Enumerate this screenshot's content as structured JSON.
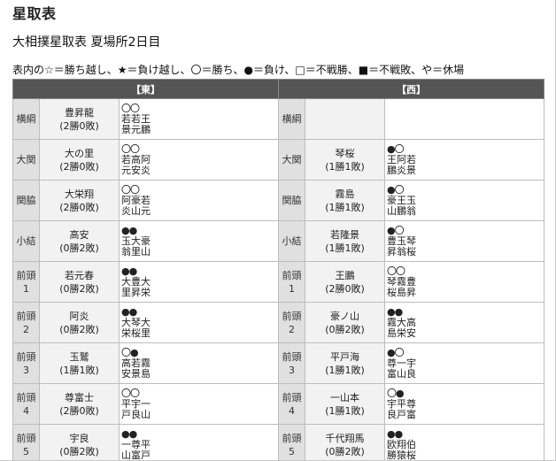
{
  "page": {
    "title": "星取表",
    "subtitle": "大相撲星取表 夏場所2日目",
    "legend": "表内の☆＝勝ち越し、★＝負け越し、〇＝勝ち、●＝負け、□＝不戦勝、■＝不戦敗、や＝休場"
  },
  "table": {
    "east_header": "【東】",
    "west_header": "【西】",
    "rows": [
      {
        "east": {
          "rank": "横綱",
          "name": "豊昇龍",
          "record": "(2勝0敗)",
          "marks": "〇〇",
          "opp1": "若若王",
          "opp2": "景元鵬"
        },
        "west": {
          "rank": "横綱",
          "name": "",
          "record": "",
          "marks": "",
          "opp1": "",
          "opp2": ""
        }
      },
      {
        "east": {
          "rank": "大関",
          "name": "大の里",
          "record": "(2勝0敗)",
          "marks": "〇〇",
          "opp1": "若高阿",
          "opp2": "元安炎"
        },
        "west": {
          "rank": "大関",
          "name": "琴桜",
          "record": "(1勝1敗)",
          "marks": "●〇",
          "opp1": "王阿若",
          "opp2": "鵬炎景"
        }
      },
      {
        "east": {
          "rank": "関脇",
          "name": "大栄翔",
          "record": "(2勝0敗)",
          "marks": "〇〇",
          "opp1": "阿豪若",
          "opp2": "炎山元"
        },
        "west": {
          "rank": "関脇",
          "name": "霧島",
          "record": "(1勝1敗)",
          "marks": "●〇",
          "opp1": "豪王玉",
          "opp2": "山鵬翁"
        }
      },
      {
        "east": {
          "rank": "小結",
          "name": "高安",
          "record": "(0勝2敗)",
          "marks": "●●",
          "opp1": "玉大豪",
          "opp2": "翁里山"
        },
        "west": {
          "rank": "小結",
          "name": "若隆景",
          "record": "(1勝1敗)",
          "marks": "●〇",
          "opp1": "豊玉琴",
          "opp2": "昇翁桜"
        }
      },
      {
        "east": {
          "rank": "前頭\n1",
          "name": "若元春",
          "record": "(0勝2敗)",
          "marks": "●●",
          "opp1": "大豊大",
          "opp2": "里昇栄"
        },
        "west": {
          "rank": "前頭\n1",
          "name": "王鵬",
          "record": "(2勝0敗)",
          "marks": "〇〇",
          "opp1": "琴霧豊",
          "opp2": "桜島昇"
        }
      },
      {
        "east": {
          "rank": "前頭\n2",
          "name": "阿炎",
          "record": "(0勝2敗)",
          "marks": "●●",
          "opp1": "大琴大",
          "opp2": "栄桜里"
        },
        "west": {
          "rank": "前頭\n2",
          "name": "豪ノ山",
          "record": "(0勝2敗)",
          "marks": "●●",
          "opp1": "霧大高",
          "opp2": "島栄安"
        }
      },
      {
        "east": {
          "rank": "前頭\n3",
          "name": "玉鷲",
          "record": "(1勝1敗)",
          "marks": "〇●",
          "opp1": "高若霧",
          "opp2": "安景島"
        },
        "west": {
          "rank": "前頭\n3",
          "name": "平戸海",
          "record": "(1勝1敗)",
          "marks": "●〇",
          "opp1": "尊一宇",
          "opp2": "富山良"
        }
      },
      {
        "east": {
          "rank": "前頭\n4",
          "name": "尊富士",
          "record": "(2勝0敗)",
          "marks": "〇〇",
          "opp1": "平宇一",
          "opp2": "戸良山"
        },
        "west": {
          "rank": "前頭\n4",
          "name": "一山本",
          "record": "(1勝1敗)",
          "marks": "〇●",
          "opp1": "宇平尊",
          "opp2": "良戸富"
        }
      },
      {
        "east": {
          "rank": "前頭\n5",
          "name": "宇良",
          "record": "(0勝2敗)",
          "marks": "●●",
          "opp1": "一尊平",
          "opp2": "山富戸"
        },
        "west": {
          "rank": "前頭\n5",
          "name": "千代翔馬",
          "record": "(0勝2敗)",
          "marks": "●●",
          "opp1": "欧翔伯",
          "opp2": "勝猿桜"
        }
      }
    ]
  }
}
